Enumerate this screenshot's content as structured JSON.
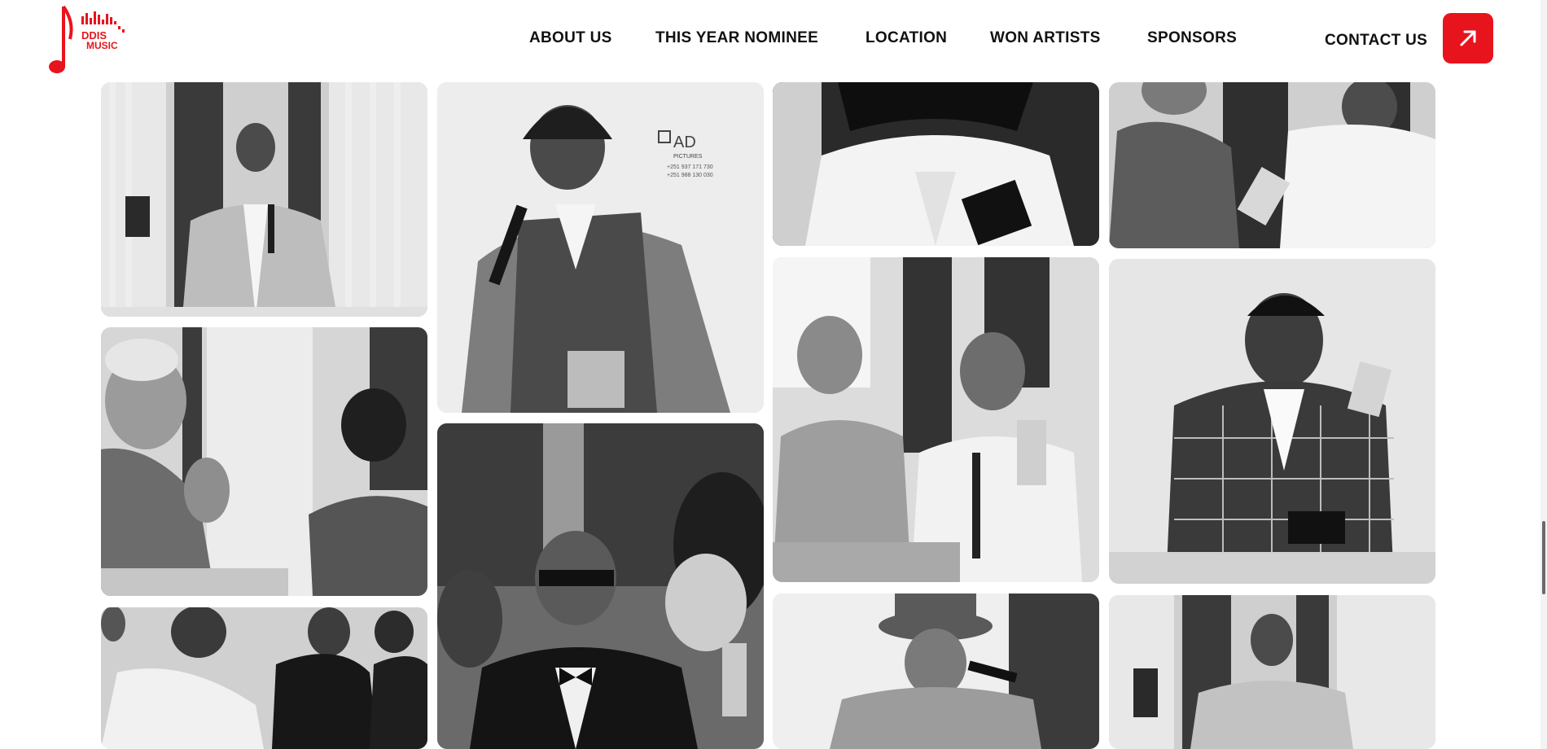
{
  "brand": {
    "logo_text_line1": "DDIS",
    "logo_text_line2": "MUSIC",
    "accent_color": "#e8141d"
  },
  "nav": {
    "items": [
      {
        "label": "ABOUT US"
      },
      {
        "label": "THIS YEAR NOMINEE"
      },
      {
        "label": "LOCATION"
      },
      {
        "label": "WON ARTISTS"
      },
      {
        "label": "SPONSORS"
      }
    ],
    "contact_label": "CONTACT US",
    "contact_icon": "arrow-up-right-icon"
  },
  "gallery": {
    "watermark_text": "AD",
    "watermark_sub": "PICTURES",
    "watermark_phone1": "+251 937 171 730",
    "watermark_phone2": "+251 988 130 030",
    "photos": [
      {
        "name": "photo-man-with-microphone-podium"
      },
      {
        "name": "photo-man-singing-with-award"
      },
      {
        "name": "photo-woman-white-jacket-award"
      },
      {
        "name": "photo-award-handover"
      },
      {
        "name": "photo-elder-clapping"
      },
      {
        "name": "photo-man-sunglasses-bowtie"
      },
      {
        "name": "photo-women-receiving-award"
      },
      {
        "name": "photo-man-checked-jacket-award"
      },
      {
        "name": "photo-handshake-ceremony"
      },
      {
        "name": "photo-man-hat-microphone"
      },
      {
        "name": "photo-man-podium-microphone"
      }
    ]
  }
}
